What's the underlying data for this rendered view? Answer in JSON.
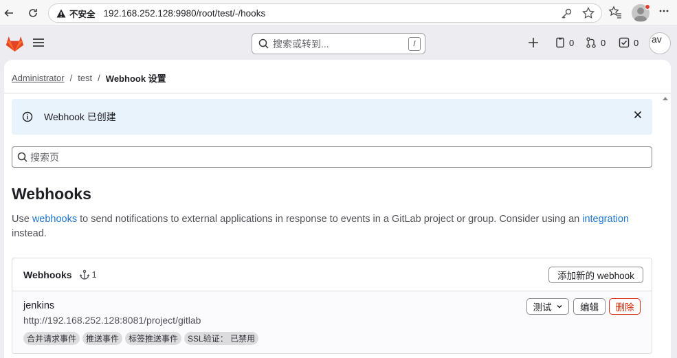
{
  "browser": {
    "insecure_label": "不安全",
    "url": "192.168.252.128:9980/root/test/-/hooks"
  },
  "topbar": {
    "search_placeholder": "搜索或转到...",
    "search_shortcut": "/",
    "issues_count": "0",
    "merge_requests_count": "0",
    "todos_count": "0",
    "avatar_alt": "av"
  },
  "breadcrumb": {
    "items": [
      "Administrator",
      "test"
    ],
    "current": "Webhook 设置"
  },
  "alert": {
    "message": "Webhook 已创建"
  },
  "page_search": {
    "placeholder": "搜索页"
  },
  "page": {
    "title": "Webhooks",
    "desc_part1": "Use ",
    "desc_link1": "webhooks",
    "desc_part2": " to send notifications to external applications in response to events in a GitLab project or group. Consider using an ",
    "desc_link2": "integration",
    "desc_part3": " instead."
  },
  "webhooks_card": {
    "title": "Webhooks",
    "count": "1",
    "add_button": "添加新的 webhook",
    "hooks": [
      {
        "name": "jenkins",
        "url": "http://192.168.252.128:8081/project/gitlab",
        "tags": [
          "合并请求事件",
          "推送事件",
          "标签推送事件",
          "SSL验证： 已禁用"
        ],
        "test_button": "测试",
        "edit_button": "编辑",
        "delete_button": "删除"
      }
    ]
  },
  "colors": {
    "accent": "#1f75cb",
    "danger": "#dd2b0e",
    "alert_bg": "#e9f3fc",
    "logo": "#e24329"
  }
}
